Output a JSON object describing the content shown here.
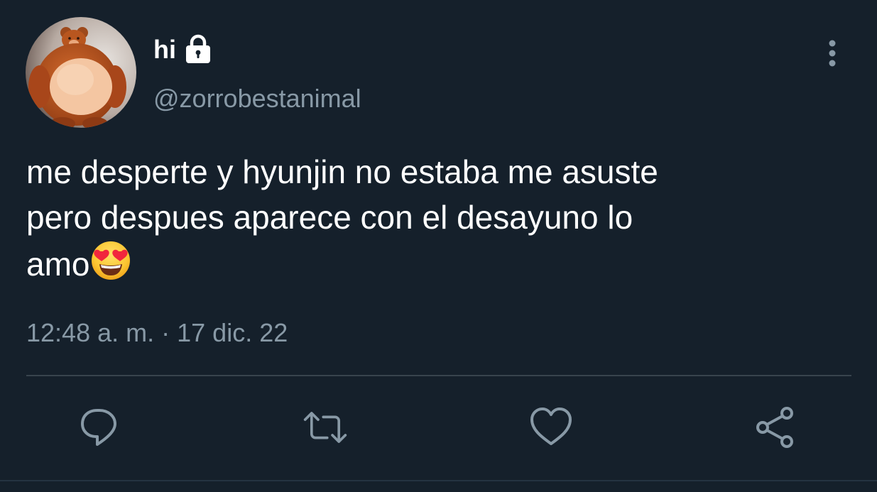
{
  "tweet": {
    "display_name": "hi",
    "handle": "@zorrobestanimal",
    "text_lines": [
      "me desperte y hyunjin no estaba me asuste",
      "pero despues aparece con el desayuno lo",
      "amo"
    ],
    "emoji": "smiling-face-with-heart-eyes",
    "time": "12:48 a. m.",
    "separator": "·",
    "date": "17 dic. 22"
  },
  "icons": {
    "lock": "lock-icon",
    "more": "vertical-ellipsis-icon",
    "reply": "reply-icon",
    "retweet": "retweet-icon",
    "like": "heart-icon",
    "share": "share-icon"
  },
  "colors": {
    "background": "#15202b",
    "text_primary": "#ffffff",
    "text_secondary": "#8899a6",
    "divider": "#38444d"
  }
}
